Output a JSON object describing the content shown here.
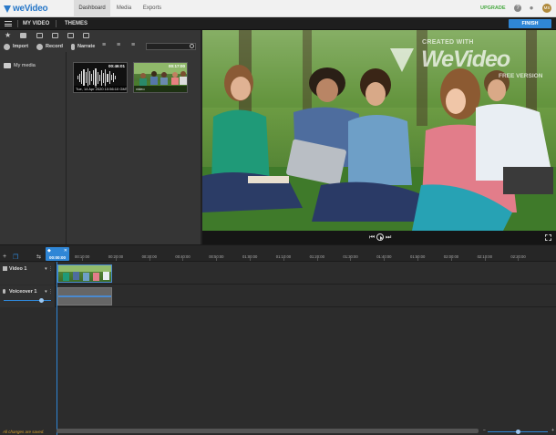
{
  "app": {
    "brand": "weVideo"
  },
  "nav": {
    "tabs": [
      "Dashboard",
      "Media",
      "Exports"
    ],
    "active_tab": "Dashboard",
    "upgrade_label": "UPGRADE",
    "avatar_initials": "MS"
  },
  "project_bar": {
    "project_name": "MY VIDEO",
    "themes_label": "THEMES",
    "finish_label": "FINISH"
  },
  "media": {
    "import_label": "Import",
    "record_label": "Record",
    "narrate_label": "Narrate",
    "search_placeholder": "",
    "folder_label": "My media",
    "items": [
      {
        "type": "audio",
        "duration": "00:46:01",
        "caption": "Tue, 14 Apr 2020 10:56:10 GMT"
      },
      {
        "type": "video",
        "duration": "00:17:00",
        "caption": "video"
      }
    ]
  },
  "preview": {
    "watermark_top": "CREATED WITH",
    "watermark_brand": "WeVideo",
    "watermark_bottom": "FREE VERSION"
  },
  "timeline": {
    "playhead_time": "00:00:00",
    "ticks": [
      "00:10:00",
      "00:20:00",
      "00:30:00",
      "00:40:00",
      "00:50:00",
      "01:00:00",
      "01:10:00",
      "01:20:00",
      "01:30:00",
      "01:40:00",
      "01:50:00",
      "02:00:00",
      "02:10:00",
      "02:20:00"
    ],
    "tracks": [
      {
        "name": "Video 1",
        "kind": "video"
      },
      {
        "name": "Voiceover 1",
        "kind": "audio",
        "volume": 0.8
      }
    ],
    "status": "All changes are saved.",
    "zoom_level": 0.5
  },
  "colors": {
    "accent": "#2f86d6",
    "upgrade": "#48a942",
    "status": "#d9a32e"
  }
}
